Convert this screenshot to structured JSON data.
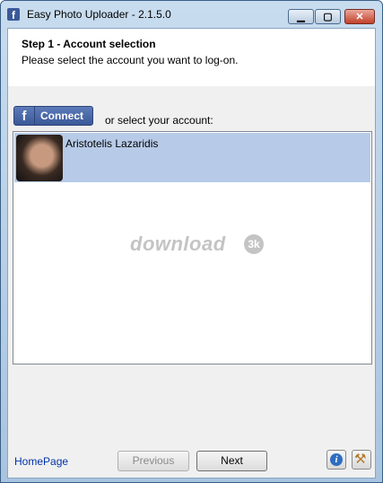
{
  "window": {
    "title": "Easy Photo Uploader - 2.1.5.0",
    "icon": "facebook-f-icon",
    "controls": {
      "minimize": "minimize-icon",
      "maximize": "maximize-icon",
      "close": "close-icon"
    }
  },
  "header": {
    "step_title": "Step 1 - Account selection",
    "step_description": "Please select the account you want to log-on."
  },
  "connect": {
    "logo": "f",
    "label": "Connect",
    "or_text": "or select your account:"
  },
  "accounts": [
    {
      "name": "Aristotelis Lazaridis",
      "selected": true
    }
  ],
  "watermark": {
    "text": "download",
    "badge": "3k"
  },
  "footer": {
    "homepage_link": "HomePage",
    "previous_label": "Previous",
    "next_label": "Next",
    "info_icon": "info-icon",
    "tools_icon": "tools-icon"
  },
  "colors": {
    "facebook_blue": "#3b5998",
    "selection": "#b7cbe8",
    "link": "#0033aa"
  }
}
